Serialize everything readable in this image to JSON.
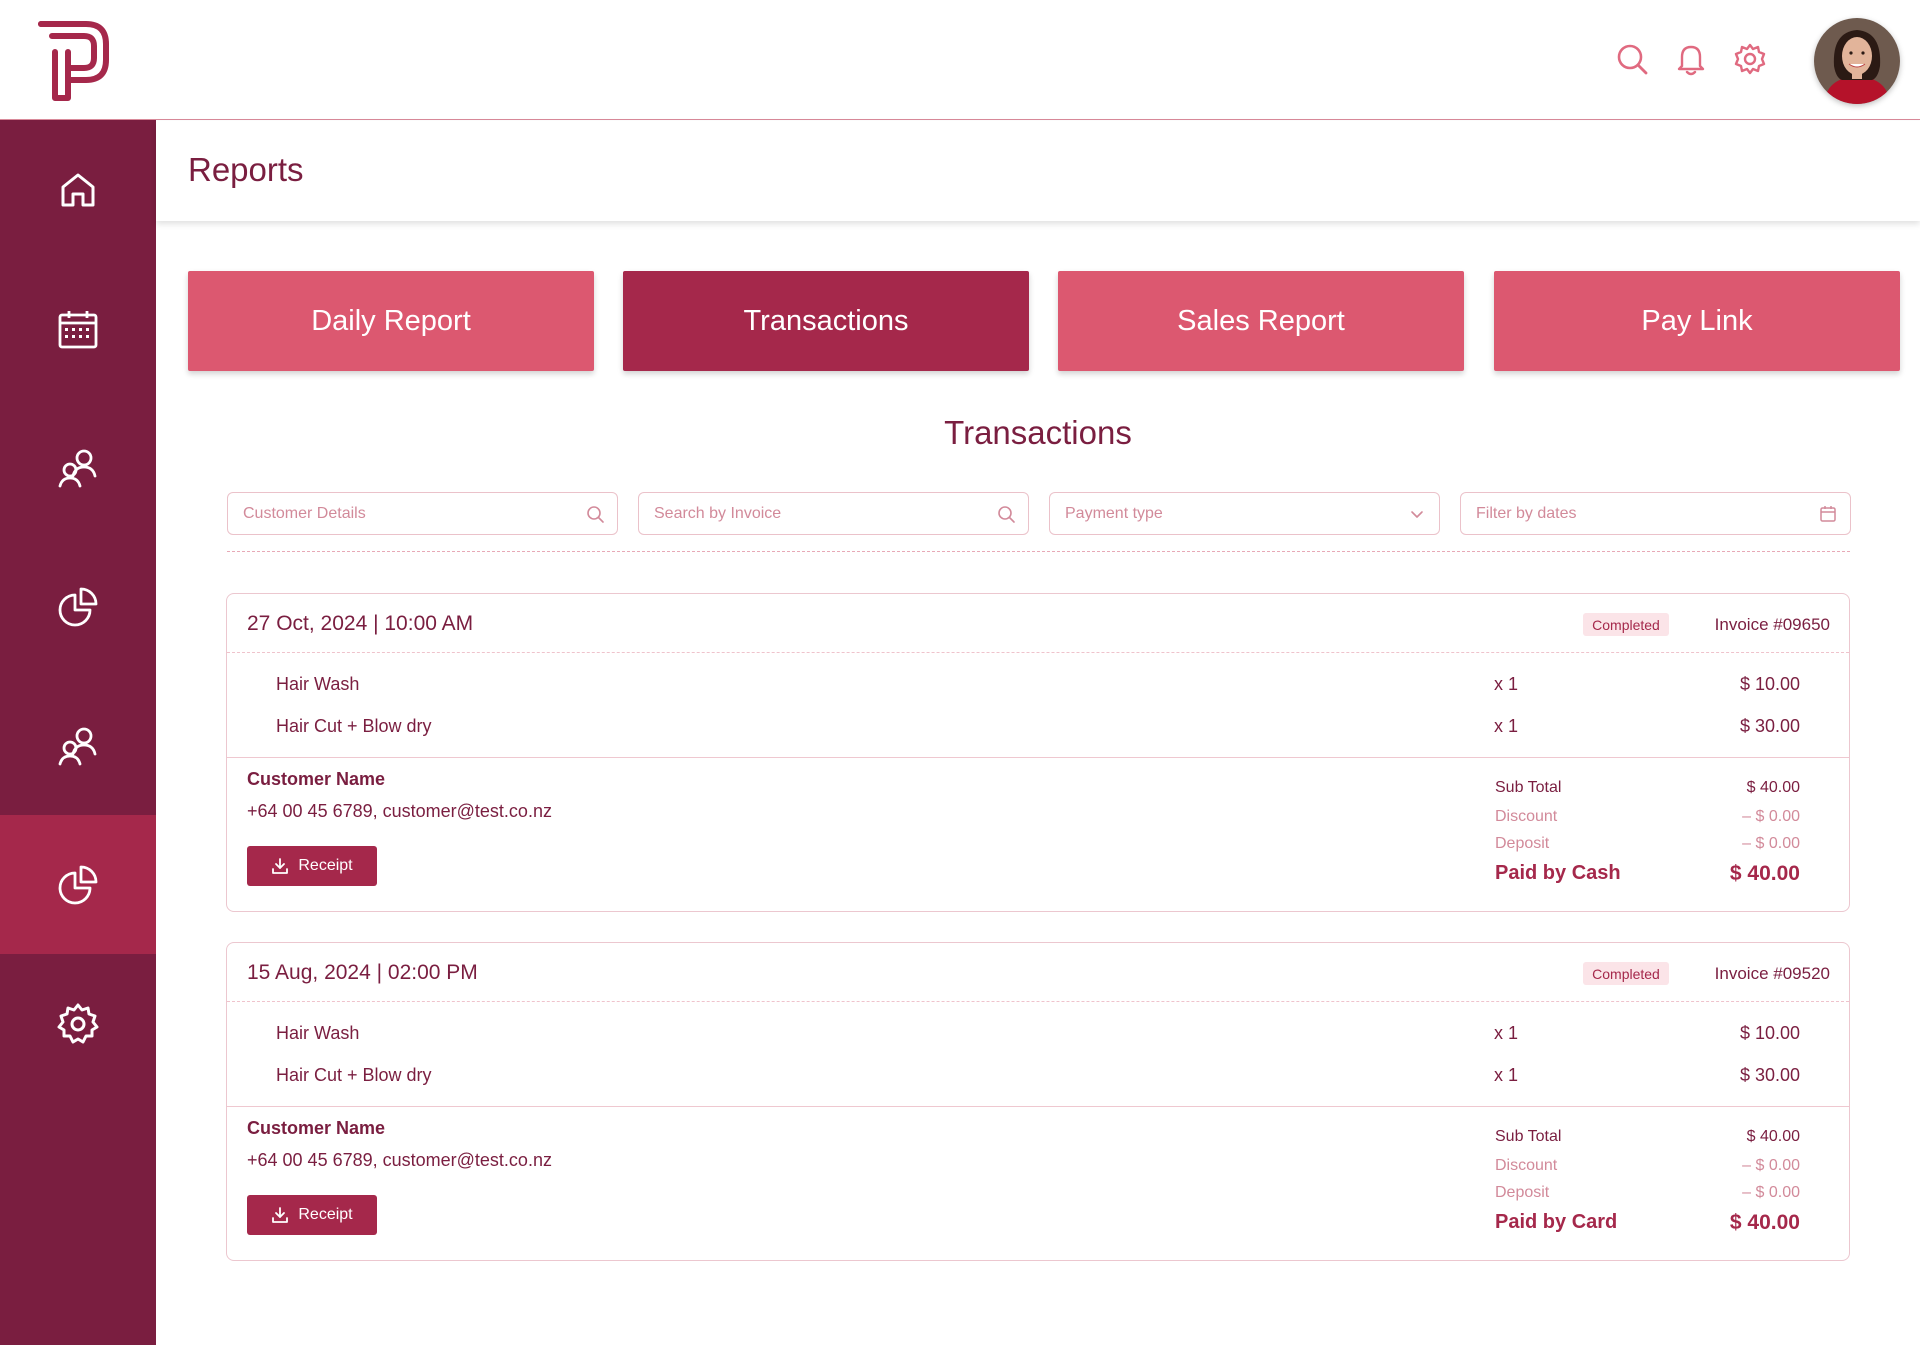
{
  "page": {
    "title": "Reports",
    "section_title": "Transactions"
  },
  "colors": {
    "brand": "#7a1e40",
    "accent": "#a5284b",
    "tab": "#dc5870",
    "badge_bg": "#fbe4e8"
  },
  "topbar": {
    "icons": [
      "search-icon",
      "bell-icon",
      "gear-icon"
    ]
  },
  "sidebar": {
    "items": [
      "home-icon",
      "calendar-icon",
      "users-icon",
      "pie-chart-icon",
      "users-icon",
      "pie-chart-icon",
      "gear-icon"
    ],
    "active_index": 5
  },
  "tabs": [
    {
      "label": "Daily Report"
    },
    {
      "label": "Transactions",
      "active": true
    },
    {
      "label": "Sales Report"
    },
    {
      "label": "Pay Link"
    }
  ],
  "filters": [
    {
      "placeholder": "Customer Details",
      "icon": "search-icon"
    },
    {
      "placeholder": "Search by Invoice",
      "icon": "search-icon"
    },
    {
      "placeholder": "Payment type",
      "icon": "chevron-down-icon"
    },
    {
      "placeholder": "Filter by dates",
      "icon": "calendar-icon"
    }
  ],
  "transactions": [
    {
      "datetime": "27 Oct, 2024 | 10:00 AM",
      "status": "Completed",
      "invoice": "Invoice #09650",
      "items": [
        {
          "name": "Hair Wash",
          "qty": "x 1",
          "price": "$ 10.00"
        },
        {
          "name": "Hair Cut + Blow dry",
          "qty": "x 1",
          "price": "$ 30.00"
        }
      ],
      "customer_name": "Customer Name",
      "customer_contact": "+64 00 45 6789, customer@test.co.nz",
      "receipt_label": "Receipt",
      "sub_total_label": "Sub Total",
      "sub_total": "$ 40.00",
      "discount_label": "Discount",
      "discount": "–  $ 0.00",
      "deposit_label": "Deposit",
      "deposit": "–  $ 0.00",
      "paid_label": "Paid by Cash",
      "paid_total": "$ 40.00"
    },
    {
      "datetime": "15 Aug, 2024 | 02:00 PM",
      "status": "Completed",
      "invoice": "Invoice #09520",
      "items": [
        {
          "name": "Hair Wash",
          "qty": "x 1",
          "price": "$ 10.00"
        },
        {
          "name": "Hair Cut + Blow dry",
          "qty": "x 1",
          "price": "$ 30.00"
        }
      ],
      "customer_name": "Customer Name",
      "customer_contact": "+64 00 45 6789, customer@test.co.nz",
      "receipt_label": "Receipt",
      "sub_total_label": "Sub Total",
      "sub_total": "$ 40.00",
      "discount_label": "Discount",
      "discount": "–  $ 0.00",
      "deposit_label": "Deposit",
      "deposit": "–  $ 0.00",
      "paid_label": "Paid by Card",
      "paid_total": "$ 40.00"
    }
  ]
}
